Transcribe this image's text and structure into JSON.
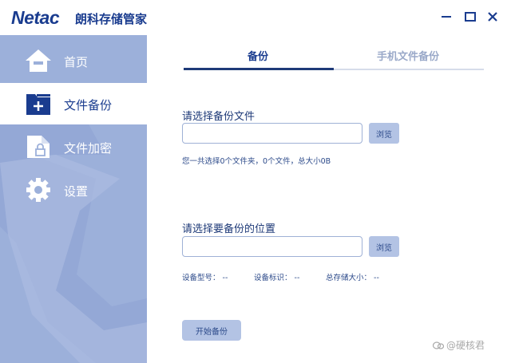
{
  "titlebar": {
    "logo": "Netac",
    "app_title": "朗科存储管家"
  },
  "sidebar": {
    "items": [
      {
        "label": "首页",
        "icon": "home-icon"
      },
      {
        "label": "文件备份",
        "icon": "folder-add-icon",
        "active": true
      },
      {
        "label": "文件加密",
        "icon": "file-lock-icon"
      },
      {
        "label": "设置",
        "icon": "gear-icon"
      }
    ]
  },
  "tabs": [
    {
      "label": "备份",
      "active": true
    },
    {
      "label": "手机文件备份",
      "active": false
    }
  ],
  "backup": {
    "select_file_label": "请选择备份文件",
    "select_file_value": "",
    "browse_label": "浏览",
    "summary": "您一共选择0个文件夹，0个文件，总大小0B",
    "select_location_label": "请选择要备份的位置",
    "select_location_value": "",
    "device_model": "设备型号： --",
    "device_id": "设备标识： --",
    "total_size": "总存储大小： --",
    "start_label": "开始备份"
  },
  "watermark": "@硬核君",
  "colors": {
    "brand": "#1a3c8f",
    "sidebar": "#9cb0da",
    "button": "#b3c3e4"
  }
}
